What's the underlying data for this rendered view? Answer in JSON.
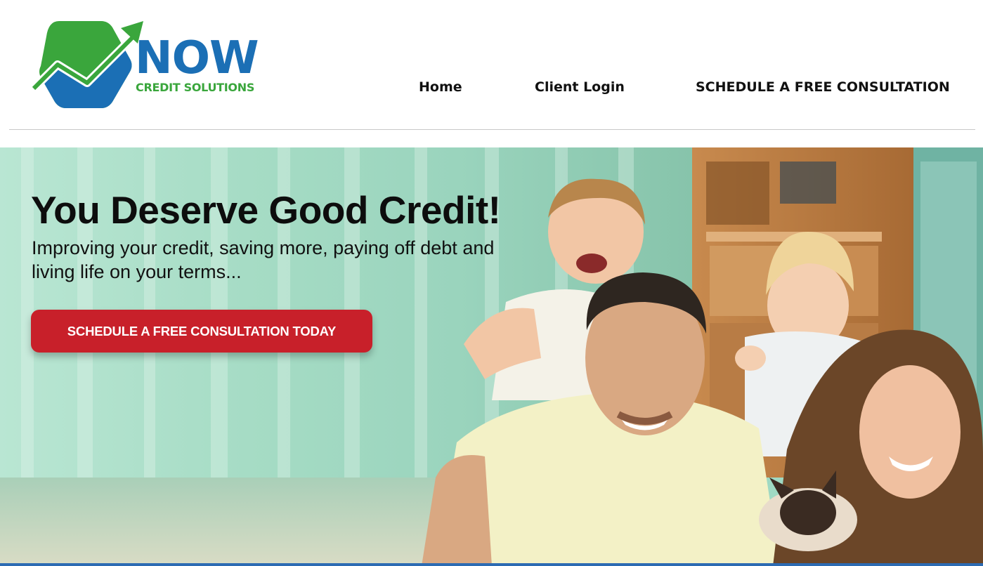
{
  "colors": {
    "logo_green": "#3aa63c",
    "logo_blue": "#1b6fb5",
    "cta_red": "#c8202a",
    "bottom_bar_blue": "#2c6bb3"
  },
  "logo": {
    "word": "NOW",
    "tagline": "CREDIT SOLUTIONS",
    "icon": "growth-arrow-hexagon-icon"
  },
  "nav": {
    "home": "Home",
    "client_login": "Client Login",
    "consultation": "SCHEDULE A FREE CONSULTATION"
  },
  "hero": {
    "title": "You Deserve Good Credit!",
    "subtitle": "Improving your credit, saving more, paying off debt and living life on your terms...",
    "cta_label": "SCHEDULE A FREE CONSULTATION TODAY",
    "image": "family-photo"
  }
}
